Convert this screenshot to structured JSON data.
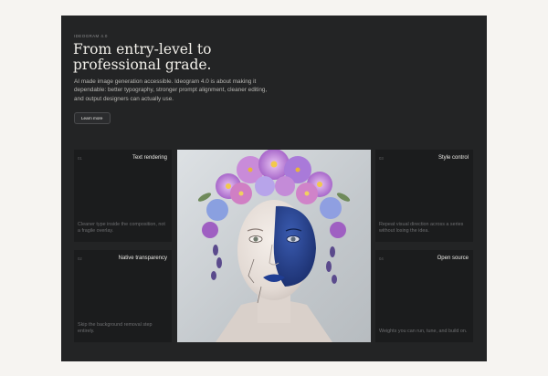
{
  "eyebrow": "IDEOGRAM 4.0",
  "headline": "From entry-level to professional grade.",
  "description": "AI made image generation accessible. Ideogram 4.0 is about making it dependable: better typography, stronger prompt alignment, cleaner editing, and output designers can actually use.",
  "learn_more": "Learn more",
  "features": [
    {
      "num": "01",
      "title": "Text rendering",
      "desc": "Cleaner type inside the composition, not a fragile overlay."
    },
    {
      "num": "02",
      "title": "Native transparency",
      "desc": "Skip the background removal step entirely."
    },
    {
      "num": "03",
      "title": "Style control",
      "desc": "Repeat visual direction across a series without losing the idea."
    },
    {
      "num": "04",
      "title": "Open source",
      "desc": "Weights you can run, tune, and build on."
    }
  ],
  "colors": {
    "page_bg": "#f6f4f1",
    "panel_bg": "#232425",
    "card_bg": "#1b1c1d",
    "accent_blue": "#23408e",
    "flower_purple": "#b66fd0"
  }
}
